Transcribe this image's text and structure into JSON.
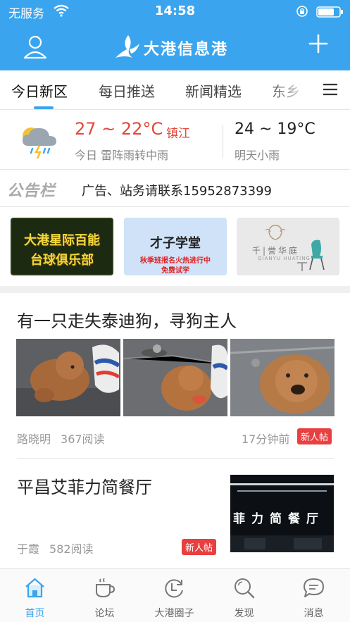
{
  "status_bar": {
    "carrier": "无服务",
    "time": "14:58"
  },
  "header": {
    "title": "大港信息港"
  },
  "tabs": [
    {
      "label": "今日新区",
      "active": true
    },
    {
      "label": "每日推送"
    },
    {
      "label": "新闻精选"
    },
    {
      "label": "东乡"
    }
  ],
  "weather": {
    "today_temp": "27 ~ 22°C",
    "city": "镇江",
    "today_desc": "今日  雷阵雨转中雨",
    "tomorrow_temp": "24 ~ 19°C",
    "tomorrow_desc": "明天小雨"
  },
  "notice": {
    "badge": "公告栏",
    "text": "广告、站务请联系15952873399"
  },
  "banners": {
    "b1": {
      "line1": "大港星际百能",
      "line2": "台球俱乐部"
    },
    "b2": {
      "script": "才子学堂",
      "line1": "秋季班报名火热进行中",
      "line2": "免费试学"
    },
    "b3": {
      "brand": "千|誉华庭",
      "sub": "QIANYU HUATING"
    }
  },
  "posts": [
    {
      "title": "有一只走失泰迪狗，寻狗主人",
      "author": "路晓明",
      "reads": "367阅读",
      "time": "17分钟前",
      "badge": "新人帖"
    },
    {
      "title": "平昌艾菲力简餐厅",
      "author": "于霞",
      "reads": "582阅读",
      "badge": "新人帖",
      "sign": "菲力简餐厅"
    }
  ],
  "bottom_nav": [
    {
      "label": "首页",
      "icon": "home-icon",
      "active": true
    },
    {
      "label": "论坛",
      "icon": "coffee-cup-icon"
    },
    {
      "label": "大港圈子",
      "icon": "circle-refresh-icon"
    },
    {
      "label": "发现",
      "icon": "search-icon"
    },
    {
      "label": "消息",
      "icon": "chat-bubble-icon"
    }
  ],
  "colors": {
    "accent": "#3aa5ee",
    "alert": "#e84040",
    "temp": "#e2483a"
  }
}
